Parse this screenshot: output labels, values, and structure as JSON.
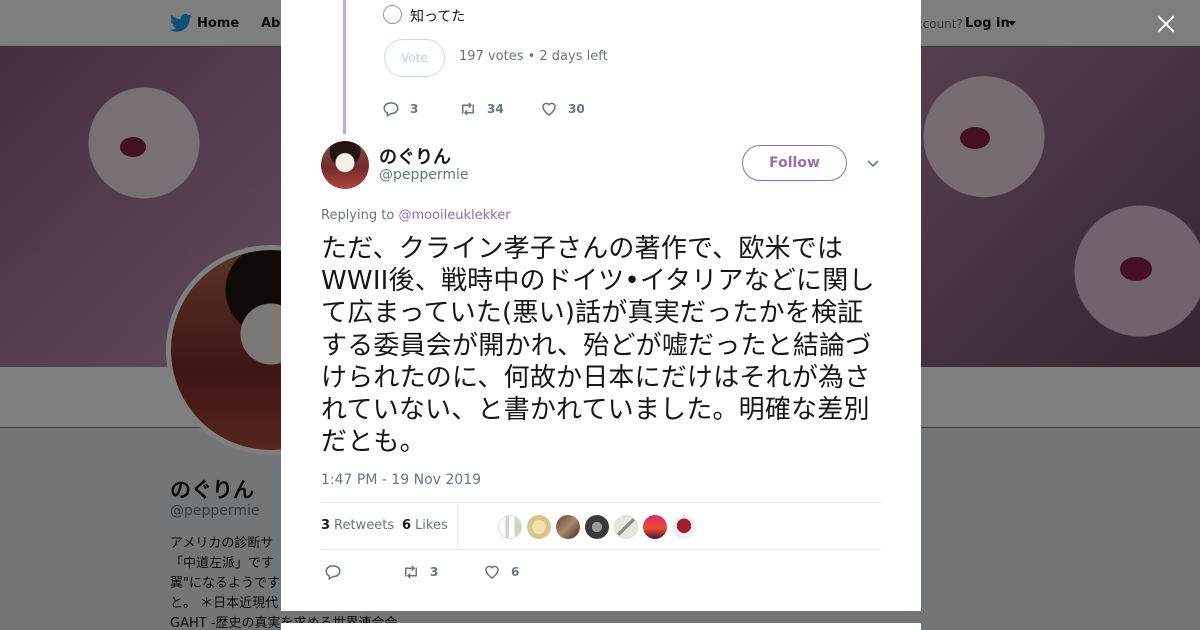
{
  "nav": {
    "home": "Home",
    "about": "Abo",
    "account_prompt": "ccount?",
    "login": "Log in"
  },
  "profile": {
    "name": "のぐりん",
    "handle": "@peppermie",
    "bio": "アメリカの診断サ\n「中道左派」です\n翼\"になるようです\nと。 ＊日本近現代\nGAHT -歴史の真実を求める世界連合会"
  },
  "poll": {
    "option": "知ってた",
    "vote_label": "Vote",
    "meta": "197 votes • 2 days left"
  },
  "parent_actions": {
    "replies": "3",
    "retweets": "34",
    "likes": "30"
  },
  "tweet": {
    "author_name": "のぐりん",
    "author_handle": "@peppermie",
    "follow_label": "Follow",
    "replying_prefix": "Replying to",
    "replying_to": "@mooileuklekker",
    "text": "ただ、クライン孝子さんの著作で、欧米ではWWII後、戦時中のドイツ•イタリアなどに関して広まっていた(悪い)話が真実だったかを検証する委員会が開かれ、殆どが嘘だったと結論づけられたのに、何故か日本にだけはそれが為されていない、と書かれていました。明確な差別だとも。",
    "timestamp": "1:47 PM - 19 Nov 2019"
  },
  "stats": {
    "retweet_count": "3",
    "retweet_label": "Retweets",
    "like_count": "6",
    "like_label": "Likes"
  },
  "tweet_actions": {
    "replies": "",
    "retweets": "3",
    "likes": "6"
  },
  "colors": {
    "accent": "#9b6bb3",
    "thread_line": "#c8a8d8",
    "muted_text": "#657786",
    "like_red": "#e0245e"
  },
  "icons": [
    "twitter-bird-icon",
    "close-icon",
    "reply-icon",
    "retweet-icon",
    "heart-icon",
    "chevron-down-icon"
  ]
}
